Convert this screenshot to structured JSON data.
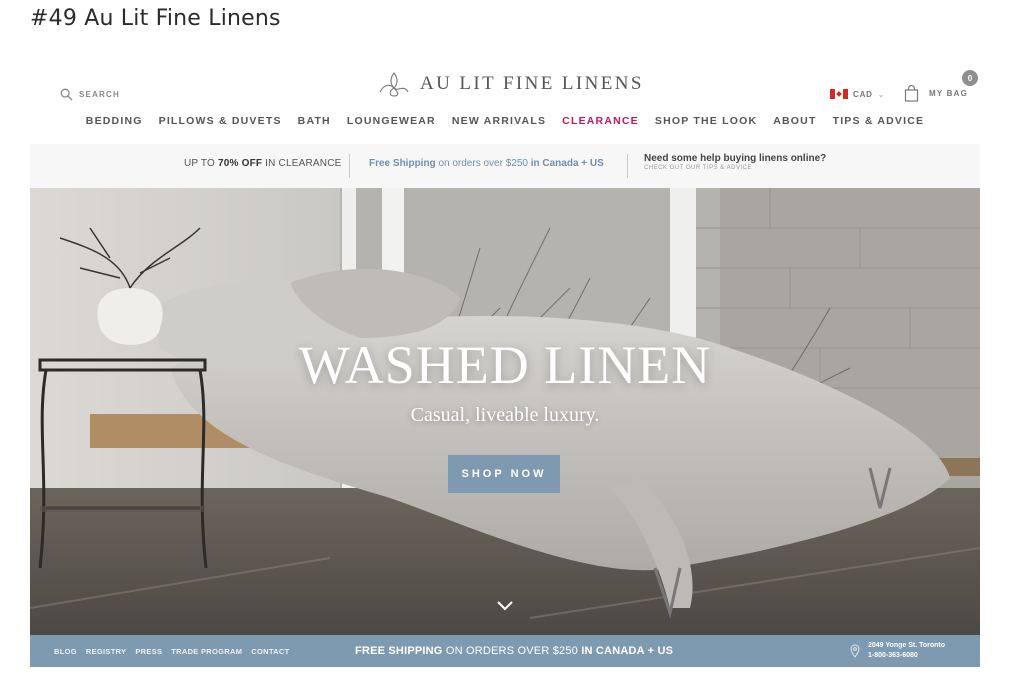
{
  "page_heading": "#49 Au Lit Fine Linens",
  "header": {
    "search_label": "SEARCH",
    "logo_text": "AU LIT FINE LINENS",
    "currency": "CAD",
    "bag_label": "MY BAG",
    "bag_count": "0"
  },
  "nav": [
    "BEDDING",
    "PILLOWS & DUVETS",
    "BATH",
    "LOUNGEWEAR",
    "NEW ARRIVALS",
    "CLEARANCE",
    "SHOP THE LOOK",
    "ABOUT",
    "TIPS & ADVICE"
  ],
  "promo": {
    "clearance_prefix": "UP TO ",
    "clearance_bold": "70% OFF",
    "clearance_suffix": " IN CLEARANCE",
    "shipping_bold1": "Free Shipping",
    "shipping_mid": " on orders over $250 ",
    "shipping_bold2": "in Canada + US",
    "help_title": "Need some help buying linens online?",
    "help_sub": "CHECK OUT OUR TIPS & ADVICE"
  },
  "hero": {
    "title": "WASHED LINEN",
    "subtitle": "Casual, liveable luxury.",
    "button": "SHOP NOW"
  },
  "footer": {
    "links": [
      "BLOG",
      "REGISTRY",
      "PRESS",
      "TRADE PROGRAM",
      "CONTACT"
    ],
    "shipping_bold1": "FREE SHIPPING",
    "shipping_mid": " ON ORDERS OVER $250 ",
    "shipping_bold2": "IN CANADA + US",
    "address_line1": "2049 Yonge St. Toronto",
    "address_line2": "1-800-363-6080"
  },
  "colors": {
    "accent_blue": "#7e9ab0",
    "clearance_pink": "#c2185b"
  }
}
